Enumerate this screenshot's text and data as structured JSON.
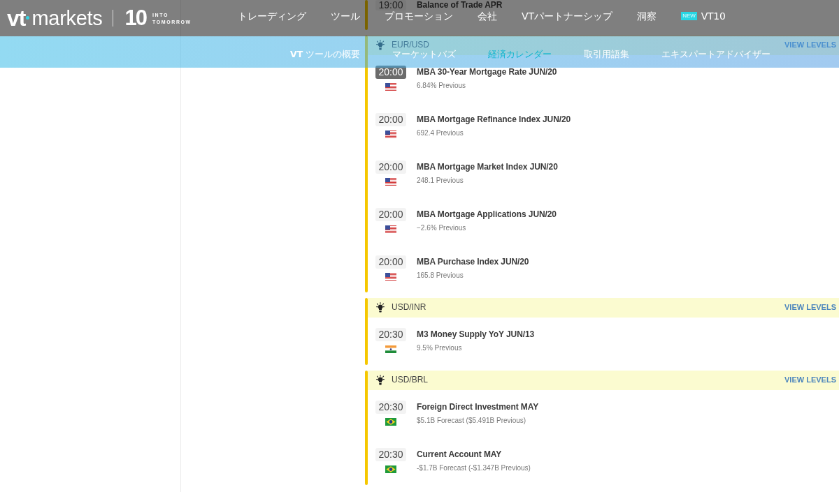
{
  "header": {
    "logo": {
      "brand": "vt",
      "brand_suffix": "markets",
      "anniversary": "10",
      "tagline": [
        "INTO",
        "TOMORROW"
      ]
    },
    "nav": [
      {
        "label": "トレーディング"
      },
      {
        "label": "ツール"
      },
      {
        "label": "プロモーション"
      },
      {
        "label": "会社"
      },
      {
        "label": "VTパートナーシップ"
      },
      {
        "label": "洞察"
      },
      {
        "label": "VT10",
        "badge": "NEW"
      }
    ]
  },
  "subnav": [
    {
      "label": "**VT** ツールの概要",
      "selected": false
    },
    {
      "label": "マーケットバズ",
      "selected": false
    },
    {
      "label": "経済カレンダー",
      "selected": true
    },
    {
      "label": "取引用語集",
      "selected": false
    },
    {
      "label": "エキスパートアドバイザー",
      "selected": false
    }
  ],
  "calendar": {
    "groups": [
      {
        "events": [
          {
            "time": "19:00",
            "highlighted": false,
            "title": "Balance of Trade APR"
          }
        ]
      },
      {
        "pair": "EUR/USD",
        "action": "VIEW LEVELS",
        "events": [
          {
            "time": "20:00",
            "highlighted": true,
            "kind": "us",
            "title": "MBA 30-Year Mortgage Rate JUN/20",
            "detail": "6.84% Previous"
          },
          {
            "time": "20:00",
            "highlighted": false,
            "kind": "us",
            "title": "MBA Mortgage Refinance Index JUN/20",
            "detail": "692.4 Previous"
          },
          {
            "time": "20:00",
            "highlighted": false,
            "kind": "us",
            "title": "MBA Mortgage Market Index JUN/20",
            "detail": "248.1 Previous"
          },
          {
            "time": "20:00",
            "highlighted": false,
            "kind": "us",
            "title": "MBA Mortgage Applications JUN/20",
            "detail": "−2.6% Previous"
          },
          {
            "time": "20:00",
            "highlighted": false,
            "kind": "us",
            "title": "MBA Purchase Index JUN/20",
            "detail": "165.8 Previous"
          }
        ]
      },
      {
        "pair": "USD/INR",
        "action": "VIEW LEVELS",
        "events": [
          {
            "time": "20:30",
            "highlighted": false,
            "kind": "in",
            "title": "M3 Money Supply YoY JUN/13",
            "detail": "9.5% Previous"
          }
        ]
      },
      {
        "pair": "USD/BRL",
        "action": "VIEW LEVELS",
        "events": [
          {
            "time": "20:30",
            "highlighted": false,
            "kind": "br",
            "title": "Foreign Direct Investment MAY",
            "detail": "$5.1B Forecast ($5.491B Previous)"
          },
          {
            "time": "20:30",
            "highlighted": false,
            "kind": "br",
            "title": "Current Account MAY",
            "detail": "-$1.7B Forecast (-$1.347B Previous)"
          }
        ]
      }
    ]
  }
}
